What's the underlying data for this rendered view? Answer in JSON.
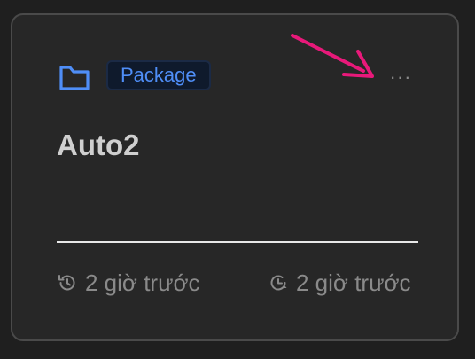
{
  "card": {
    "badge_label": "Package",
    "more_label": "···",
    "title": "Auto2",
    "history_text": "2 giờ trước",
    "updated_text": "2 giờ trước"
  },
  "icons": {
    "folder": "folder-icon",
    "history": "history-icon",
    "clock": "clock-update-icon",
    "more": "more-horizontal-icon",
    "annotation": "pointer-arrow-icon"
  },
  "colors": {
    "background": "#1f1f1f",
    "card_background": "#272727",
    "card_border": "#4a4a4a",
    "accent_blue": "#4f8ef7",
    "badge_background": "#0f1a2c",
    "title_text": "#cfcfcf",
    "muted_text": "#8a8a8a",
    "divider": "#e8e8e8",
    "annotation_arrow": "#e8197a"
  }
}
